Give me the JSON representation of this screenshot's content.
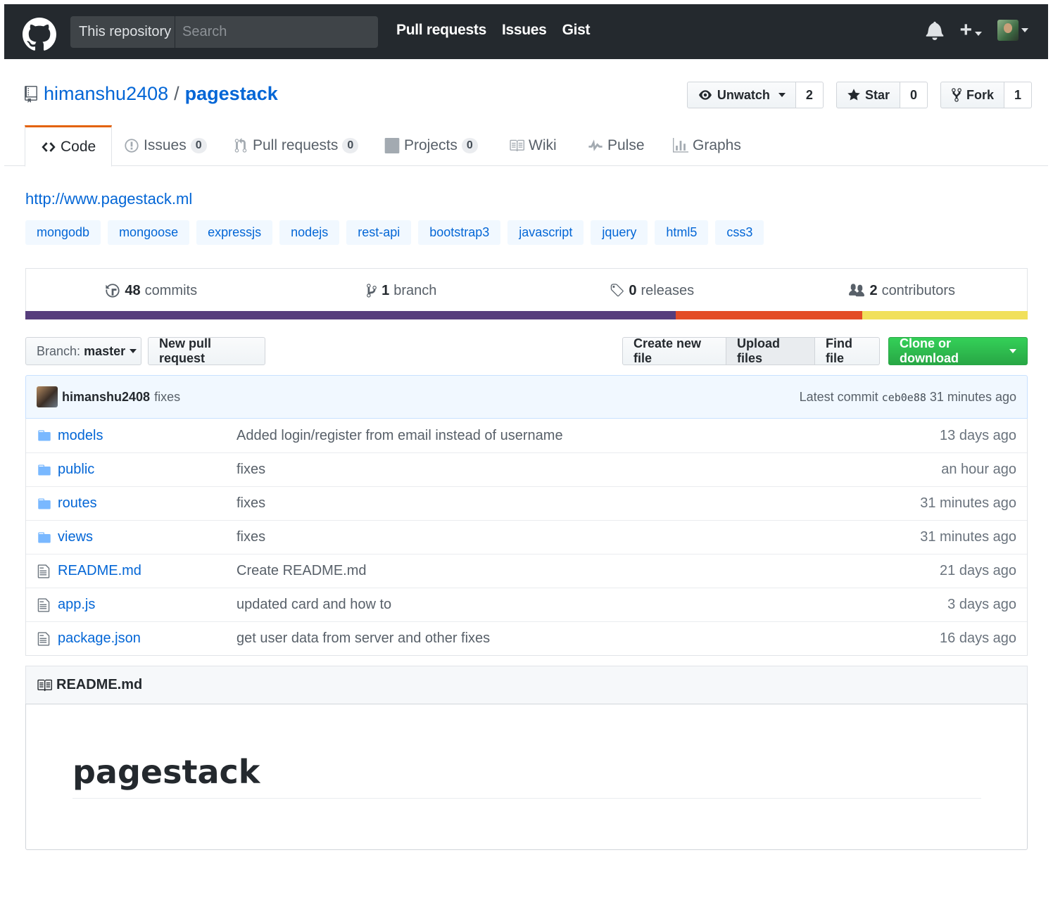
{
  "header": {
    "scope": "This repository",
    "search_placeholder": "Search",
    "nav": [
      "Pull requests",
      "Issues",
      "Gist"
    ]
  },
  "repo": {
    "owner": "himanshu2408",
    "separator": "/",
    "name": "pagestack",
    "watch": {
      "label": "Unwatch",
      "count": "2"
    },
    "star": {
      "label": "Star",
      "count": "0"
    },
    "fork": {
      "label": "Fork",
      "count": "1"
    }
  },
  "tabs": [
    {
      "label": "Code",
      "count": null,
      "icon": "code-icon"
    },
    {
      "label": "Issues",
      "count": "0",
      "icon": "issue-icon"
    },
    {
      "label": "Pull requests",
      "count": "0",
      "icon": "pull-request-icon"
    },
    {
      "label": "Projects",
      "count": "0",
      "icon": "project-icon"
    },
    {
      "label": "Wiki",
      "count": null,
      "icon": "book-icon"
    },
    {
      "label": "Pulse",
      "count": null,
      "icon": "pulse-icon"
    },
    {
      "label": "Graphs",
      "count": null,
      "icon": "graph-icon"
    }
  ],
  "homepage": "http://www.pagestack.ml",
  "topics": [
    "mongodb",
    "mongoose",
    "expressjs",
    "nodejs",
    "rest-api",
    "bootstrap3",
    "javascript",
    "jquery",
    "html5",
    "css3"
  ],
  "summary": {
    "commits": {
      "num": "48",
      "label": "commits"
    },
    "branches": {
      "num": "1",
      "label": "branch"
    },
    "releases": {
      "num": "0",
      "label": "releases"
    },
    "contributors": {
      "num": "2",
      "label": "contributors"
    }
  },
  "languages": [
    {
      "color": "#563d7c",
      "share": 0.649
    },
    {
      "color": "#e34c26",
      "share": 0.186
    },
    {
      "color": "#f1e05a",
      "share": 0.165
    }
  ],
  "file_nav": {
    "branch_prefix": "Branch:",
    "branch": "master",
    "new_pr": "New pull request",
    "create_file": "Create new file",
    "upload_files": "Upload files",
    "find_file": "Find file",
    "clone": "Clone or download"
  },
  "commit": {
    "author": "himanshu2408",
    "message": "fixes",
    "latest_label": "Latest commit",
    "sha": "ceb0e88",
    "age": "31 minutes ago"
  },
  "files": [
    {
      "type": "dir",
      "name": "models",
      "message": "Added login/register from email instead of username",
      "age": "13 days ago"
    },
    {
      "type": "dir",
      "name": "public",
      "message": "fixes",
      "age": "an hour ago"
    },
    {
      "type": "dir",
      "name": "routes",
      "message": "fixes",
      "age": "31 minutes ago"
    },
    {
      "type": "dir",
      "name": "views",
      "message": "fixes",
      "age": "31 minutes ago"
    },
    {
      "type": "file",
      "name": "README.md",
      "message": "Create README.md",
      "age": "21 days ago"
    },
    {
      "type": "file",
      "name": "app.js",
      "message": "updated card and how to",
      "age": "3 days ago"
    },
    {
      "type": "file",
      "name": "package.json",
      "message": "get user data from server and other fixes",
      "age": "16 days ago"
    }
  ],
  "readme": {
    "filename": "README.md",
    "heading": "pagestack"
  }
}
